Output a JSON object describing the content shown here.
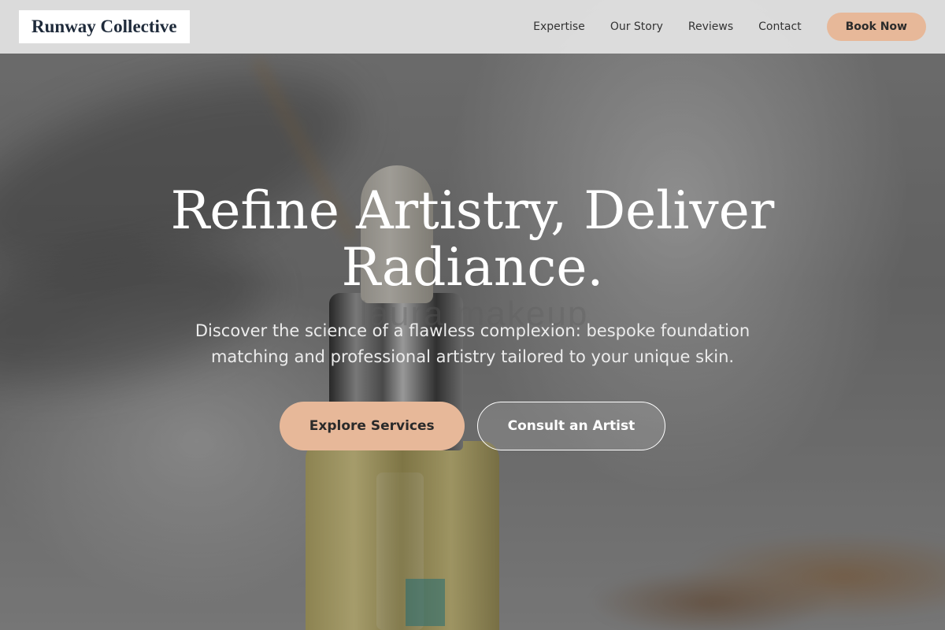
{
  "header": {
    "brand": "Runway Collective",
    "nav": [
      {
        "label": "Expertise"
      },
      {
        "label": "Our Story"
      },
      {
        "label": "Reviews"
      },
      {
        "label": "Contact"
      }
    ],
    "cta_label": "Book Now"
  },
  "hero": {
    "title": "Refine Artistry, Deliver Radiance.",
    "subtitle": "Discover the science of a flawless complexion: bespoke foundation matching and professional artistry tailored to your unique skin.",
    "primary_cta": "Explore Services",
    "secondary_cta": "Consult an Artist",
    "background_label_text": "laura makeup"
  },
  "colors": {
    "accent": "#e7b899",
    "header_bg": "#e0e0e0",
    "brand_text": "#1e2a3a",
    "hero_text": "#ffffff"
  }
}
